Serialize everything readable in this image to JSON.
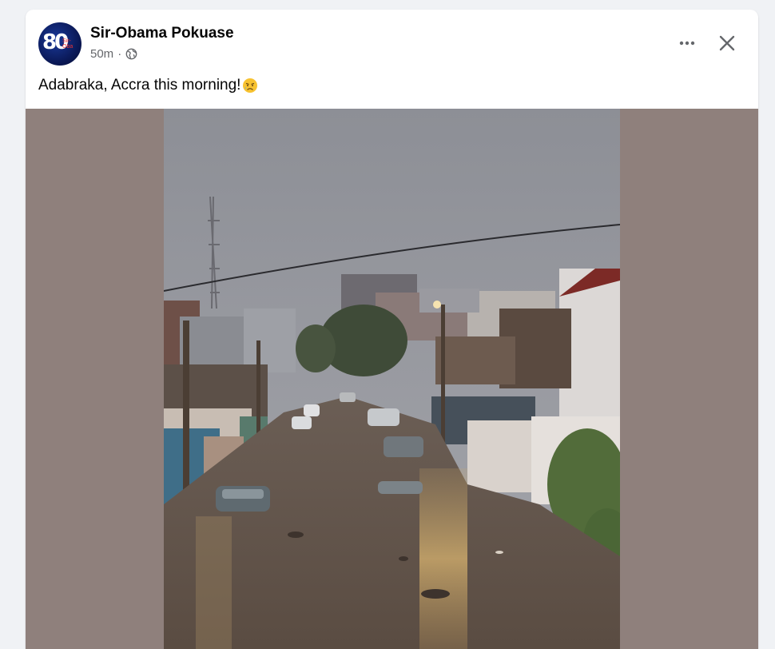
{
  "post": {
    "author": "Sir-Obama Pokuase",
    "time": "50m",
    "separator": "·",
    "audience_icon": "globe-icon",
    "caption": "Adabraka, Accra this morning!",
    "caption_emoji": "sad-but-relieved-face-emoji",
    "more_icon": "more-options-icon",
    "close_icon": "close-icon"
  },
  "avatar": {
    "logo_text": "80",
    "logo_small": "Sir-Oba"
  },
  "colors": {
    "page_bg": "#f0f2f5",
    "card_bg": "#ffffff",
    "media_letterbox": "#8f807c",
    "secondary_text": "#65676b"
  }
}
